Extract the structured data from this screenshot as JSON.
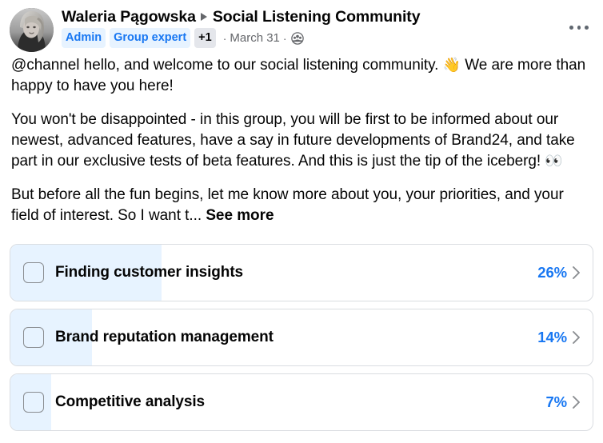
{
  "post": {
    "author": {
      "name": "Waleria Pągowska",
      "avatar_icon": "user-portrait-avatar"
    },
    "group": "Social Listening Community",
    "separator_icon": "caret-right-icon",
    "badges": [
      {
        "label": "Admin",
        "style": "blue"
      },
      {
        "label": "Group expert",
        "style": "blue"
      },
      {
        "label": "+1",
        "style": "gray"
      }
    ],
    "dot": "·",
    "date": "March 31",
    "privacy_icon": "group-members-icon",
    "menu_button": {
      "name": "post-options-menu",
      "icon": "ellipsis-horizontal-icon"
    },
    "paragraphs": [
      {
        "text": "@channel hello, and welcome to our social listening community. ",
        "emoji": "👋",
        "text_after": "We are more than happy to have you here!"
      },
      {
        "text": "You won't be disappointed - in this group, you will be first to be informed about our newest, advanced features, have a say in future developments of Brand24, and take part in our exclusive tests of beta features. And this is just the tip of the iceberg! ",
        "emoji": "👀",
        "text_after": ""
      },
      {
        "text": "But before all the fun begins, let me know more about you, your priorities, and your field of interest. So I want t...",
        "emoji": "",
        "text_after": ""
      }
    ],
    "see_more_label": "See more"
  },
  "poll": {
    "chevron_icon": "chevron-right-icon",
    "options": [
      {
        "label": "Finding customer insights",
        "percent_label": "26%",
        "percent": 26,
        "checked": false
      },
      {
        "label": "Brand reputation management",
        "percent_label": "14%",
        "percent": 14,
        "checked": false
      },
      {
        "label": "Competitive analysis",
        "percent_label": "7%",
        "percent": 7,
        "checked": false
      }
    ]
  },
  "colors": {
    "accent_blue": "#1877f2",
    "fill_blue": "#e7f3ff",
    "badge_gray": "#e4e6eb",
    "text_primary": "#050505",
    "text_secondary": "#65676b",
    "border": "#dadde1"
  }
}
